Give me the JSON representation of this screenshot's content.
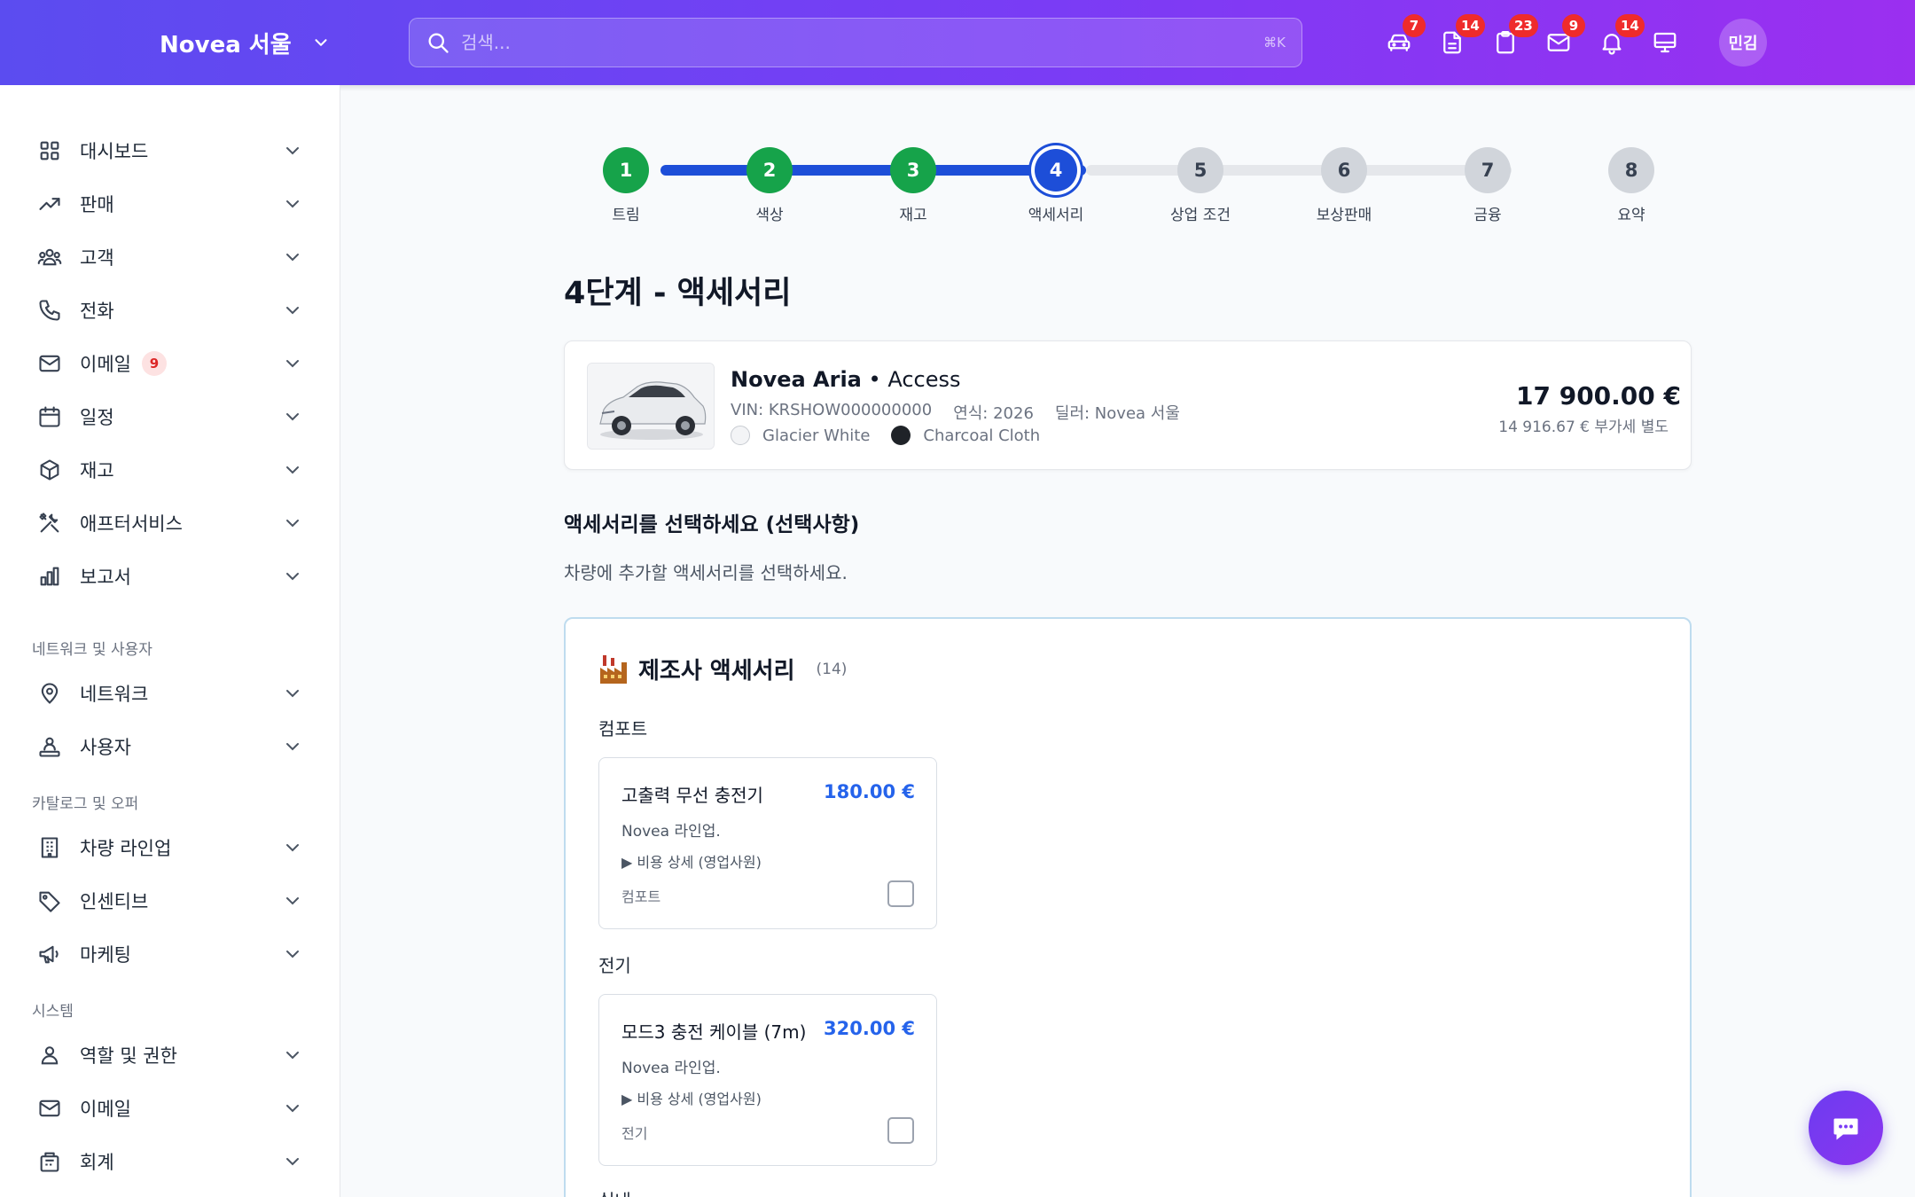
{
  "header": {
    "brand": "Novea 서울",
    "search_placeholder": "검색...",
    "search_shortcut": "⌘K",
    "icons": [
      {
        "name": "car-icon",
        "badge": "7"
      },
      {
        "name": "document-icon",
        "badge": "14"
      },
      {
        "name": "clipboard-icon",
        "badge": "23"
      },
      {
        "name": "mail-icon",
        "badge": "9"
      },
      {
        "name": "bell-icon",
        "badge": "14"
      },
      {
        "name": "monitor-icon",
        "badge": ""
      }
    ],
    "avatar": "민김"
  },
  "sidebar": {
    "items": [
      {
        "label": "대시보드",
        "icon": "dashboard-grid-icon"
      },
      {
        "label": "판매",
        "icon": "trending-up-icon"
      },
      {
        "label": "고객",
        "icon": "users-icon"
      },
      {
        "label": "전화",
        "icon": "phone-icon"
      },
      {
        "label": "이메일",
        "icon": "mail-icon",
        "badge": "9"
      },
      {
        "label": "일정",
        "icon": "calendar-icon"
      },
      {
        "label": "재고",
        "icon": "box-icon"
      },
      {
        "label": "애프터서비스",
        "icon": "tools-icon"
      },
      {
        "label": "보고서",
        "icon": "bar-chart-icon"
      }
    ],
    "sections": [
      {
        "title": "네트워크 및 사용자",
        "items": [
          {
            "label": "네트워크",
            "icon": "map-pin-icon"
          },
          {
            "label": "사용자",
            "icon": "user-network-icon"
          }
        ]
      },
      {
        "title": "카탈로그 및 오퍼",
        "items": [
          {
            "label": "차량 라인업",
            "icon": "building-icon"
          },
          {
            "label": "인센티브",
            "icon": "tag-icon"
          },
          {
            "label": "마케팅",
            "icon": "megaphone-icon"
          }
        ]
      },
      {
        "title": "시스템",
        "items": [
          {
            "label": "역할 및 권한",
            "icon": "user-icon"
          },
          {
            "label": "이메일",
            "icon": "mail-icon"
          },
          {
            "label": "회계",
            "icon": "accounting-icon"
          }
        ]
      }
    ]
  },
  "stepper": {
    "current": 4,
    "steps": [
      {
        "num": "1",
        "label": "트림",
        "state": "done"
      },
      {
        "num": "2",
        "label": "색상",
        "state": "done"
      },
      {
        "num": "3",
        "label": "재고",
        "state": "done"
      },
      {
        "num": "4",
        "label": "액세서리",
        "state": "current"
      },
      {
        "num": "5",
        "label": "상업 조건",
        "state": "todo"
      },
      {
        "num": "6",
        "label": "보상판매",
        "state": "todo"
      },
      {
        "num": "7",
        "label": "금융",
        "state": "todo"
      },
      {
        "num": "8",
        "label": "요약",
        "state": "todo"
      }
    ]
  },
  "page": {
    "title": "4단계 - 액세서리",
    "vehicle": {
      "model": "Novea Aria",
      "trim": "• Access",
      "vin": "VIN: KRSHOW000000000",
      "year": "연식: 2026",
      "dealer": "딜러: Novea 서울",
      "exterior_color": "Glacier White",
      "exterior_color_hex": "#f3f4f6",
      "interior_color": "Charcoal Cloth",
      "interior_color_hex": "#1f2328",
      "price": "17 900.00 €",
      "price_ex_vat": "14 916.67 € 부가세 별도"
    },
    "section_heading": "액세서리를 선택하세요 (선택사항)",
    "section_desc": "차량에 추가할 액세서리를 선택하세요.",
    "panel": {
      "title": "제조사 액세서리",
      "count": "(14)",
      "groups": [
        {
          "category": "컴포트",
          "item": {
            "name": "고출력 무선 충전기",
            "price": "180.00 €",
            "maker": "Novea 라인업.",
            "detail": "▶ 비용 상세 (영업사원)",
            "tag": "컴포트",
            "checked": false
          }
        },
        {
          "category": "전기",
          "item": {
            "name": "모드3 충전 케이블 (7m)",
            "price": "320.00 €",
            "maker": "Novea 라인업.",
            "detail": "▶ 비용 상세 (영업사원)",
            "tag": "전기",
            "checked": false
          }
        }
      ],
      "next_category": "실내"
    }
  },
  "colors": {
    "accent": "#1d4ed8",
    "done": "#16a34a",
    "brand_start": "#5b4cf0",
    "brand_end": "#9b2ff0",
    "price": "#2563eb"
  }
}
